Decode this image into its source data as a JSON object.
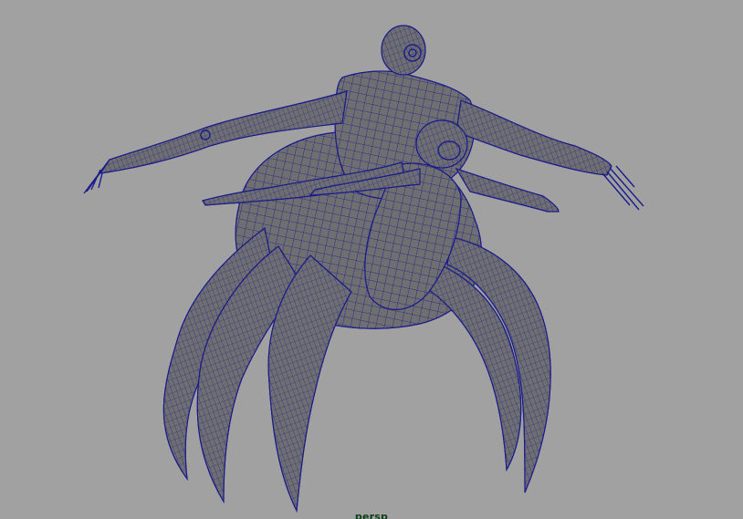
{
  "viewport": {
    "camera_name": "persp",
    "background_color": "#a1a1a1",
    "mesh_fill_color": "#6f6f72",
    "mesh_shadow_color": "#5c5c60",
    "wireframe_color": "#1c1c8a",
    "label_color": "#0b3f12",
    "model_icon": "creature-mesh-icon"
  }
}
